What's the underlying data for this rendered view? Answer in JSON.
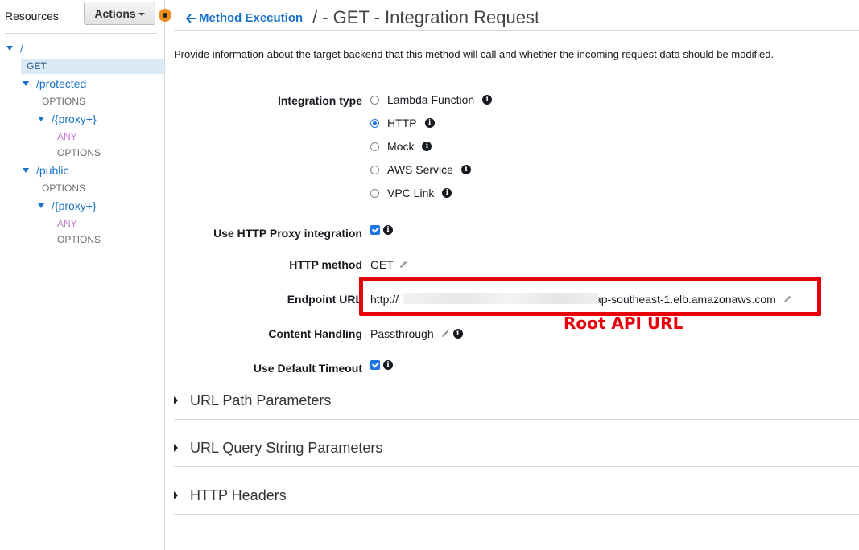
{
  "sidebar": {
    "title": "Resources",
    "actions_label": "Actions",
    "tree": {
      "root": "/",
      "root_get": "GET",
      "protected": "/protected",
      "protected_options": "OPTIONS",
      "protected_proxy": "/{proxy+}",
      "protected_proxy_any": "ANY",
      "protected_proxy_options": "OPTIONS",
      "public": "/public",
      "public_options": "OPTIONS",
      "public_proxy": "/{proxy+}",
      "public_proxy_any": "ANY",
      "public_proxy_options": "OPTIONS"
    }
  },
  "header": {
    "back_label": "Method Execution",
    "title": "/ - GET - Integration Request"
  },
  "description": "Provide information about the target backend that this method will call and whether the incoming request data should be modified.",
  "form": {
    "integration_type_label": "Integration type",
    "integration_types": [
      {
        "label": "Lambda Function",
        "checked": false
      },
      {
        "label": "HTTP",
        "checked": true
      },
      {
        "label": "Mock",
        "checked": false
      },
      {
        "label": "AWS Service",
        "checked": false
      },
      {
        "label": "VPC Link",
        "checked": false
      }
    ],
    "proxy_label": "Use HTTP Proxy integration",
    "proxy_checked": true,
    "http_method_label": "HTTP method",
    "http_method_value": "GET",
    "endpoint_label": "Endpoint URL",
    "endpoint_prefix": "http://",
    "endpoint_suffix": ".ap-southeast-1.elb.amazonaws.com",
    "content_handling_label": "Content Handling",
    "content_handling_value": "Passthrough",
    "timeout_label": "Use Default Timeout",
    "timeout_checked": true
  },
  "annotation": "Root API URL",
  "sections": [
    "URL Path Parameters",
    "URL Query String Parameters",
    "HTTP Headers"
  ],
  "colors": {
    "link": "#1a73c9",
    "highlight": "#e8000b",
    "accent_orange": "#ec8d1c",
    "check_blue": "#1a73e8"
  }
}
